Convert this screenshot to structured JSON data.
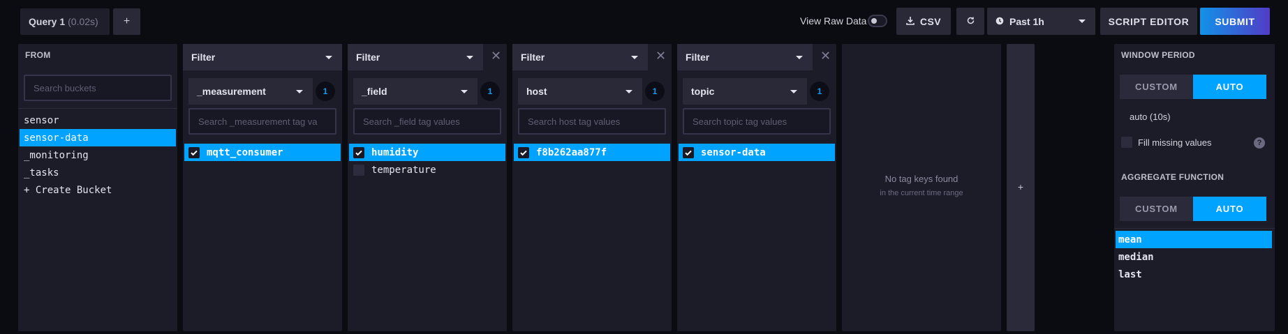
{
  "toolbar": {
    "query_tab": "Query 1",
    "query_time": "(0.02s)",
    "add_query": "+",
    "raw_data_label": "View Raw Data",
    "csv_label": "CSV",
    "time_range": "Past 1h",
    "script_editor": "SCRIPT EDITOR",
    "submit": "SUBMIT"
  },
  "from": {
    "title": "FROM",
    "search_placeholder": "Search buckets",
    "buckets": [
      "sensor",
      "sensor-data",
      "_monitoring",
      "_tasks",
      "+ Create Bucket"
    ],
    "selected": "sensor-data"
  },
  "filters": [
    {
      "label": "Filter",
      "key": "_measurement",
      "count": "1",
      "search_placeholder": "Search _measurement tag va",
      "values": [
        "mqtt_consumer"
      ],
      "checked": [
        "mqtt_consumer"
      ]
    },
    {
      "label": "Filter",
      "key": "_field",
      "count": "1",
      "search_placeholder": "Search _field tag values",
      "values": [
        "humidity",
        "temperature"
      ],
      "checked": [
        "humidity"
      ]
    },
    {
      "label": "Filter",
      "key": "host",
      "count": "1",
      "search_placeholder": "Search host tag values",
      "values": [
        "f8b262aa877f"
      ],
      "checked": [
        "f8b262aa877f"
      ]
    },
    {
      "label": "Filter",
      "key": "topic",
      "count": "1",
      "search_placeholder": "Search topic tag values",
      "values": [
        "sensor-data"
      ],
      "checked": [
        "sensor-data"
      ]
    }
  ],
  "empty_panel": {
    "title": "No tag keys found",
    "subtitle": "in the current time range"
  },
  "add_filter": "+",
  "aggregate": {
    "window_period_title": "WINDOW PERIOD",
    "window_custom": "CUSTOM",
    "window_auto": "AUTO",
    "window_value": "auto (10s)",
    "fill_missing": "Fill missing values",
    "function_title": "AGGREGATE FUNCTION",
    "fn_custom": "CUSTOM",
    "fn_auto": "AUTO",
    "functions": [
      "mean",
      "median",
      "last"
    ],
    "selected_function": "mean"
  },
  "colors": {
    "accent": "#00a3ff",
    "background": "#0b0b12",
    "panel": "#1c1c29",
    "submit_gradient_start": "#1192e8",
    "submit_gradient_end": "#513cc6"
  }
}
